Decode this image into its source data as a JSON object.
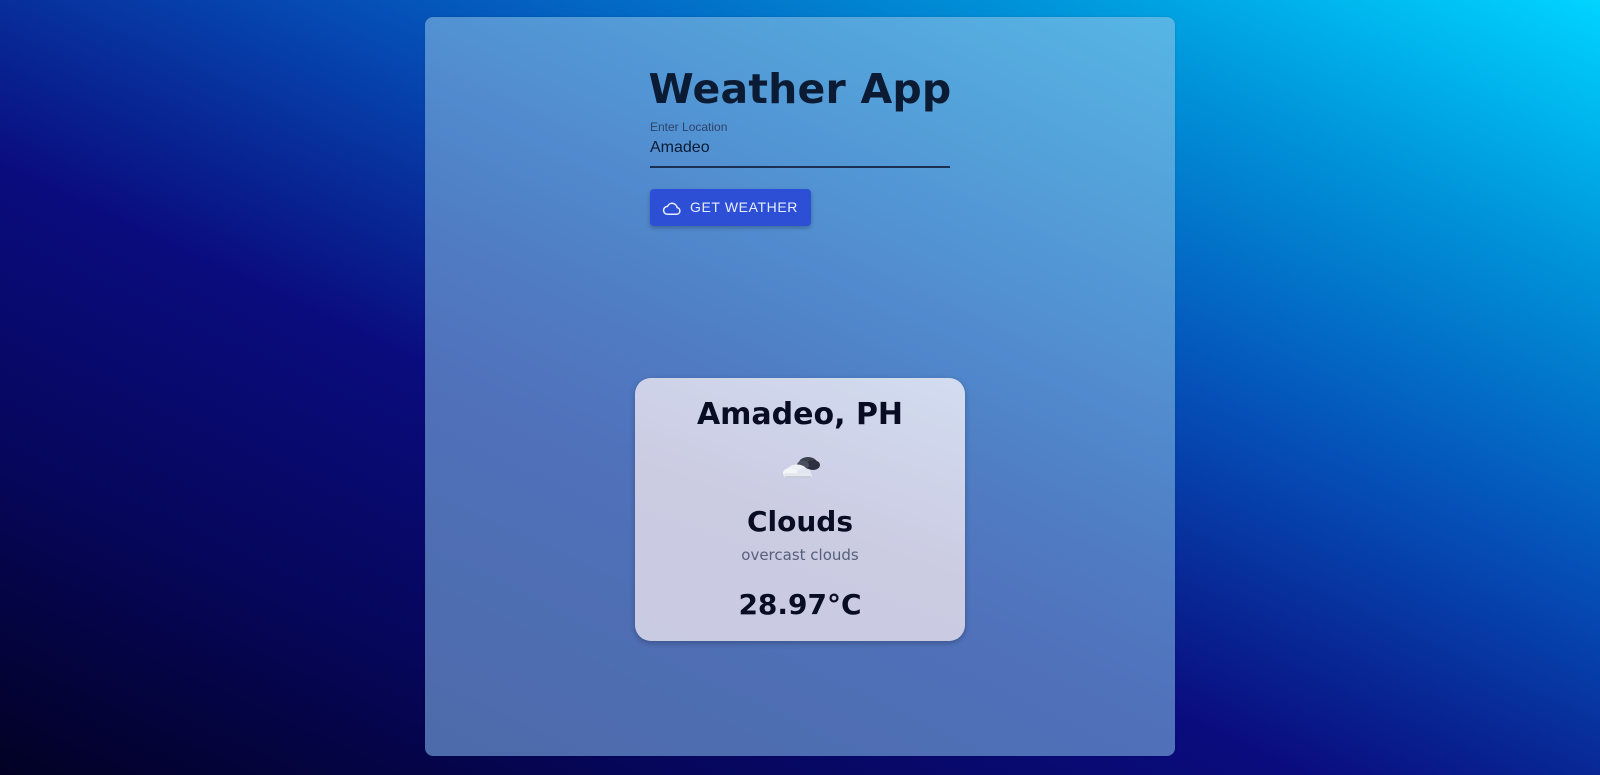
{
  "app": {
    "title": "Weather App"
  },
  "search": {
    "label": "Enter Location",
    "value": "Amadeo",
    "placeholder": ""
  },
  "button": {
    "label": "GET WEATHER",
    "icon": "cloud-outline-icon"
  },
  "weather": {
    "location": "Amadeo, PH",
    "icon": "overcast-clouds-icon",
    "main": "Clouds",
    "description": "overcast clouds",
    "temperature": "28.97°C"
  },
  "colors": {
    "button_bg": "#2c4fd6",
    "title_text": "#0b1b33",
    "card_bg": "#cbcbe2"
  }
}
